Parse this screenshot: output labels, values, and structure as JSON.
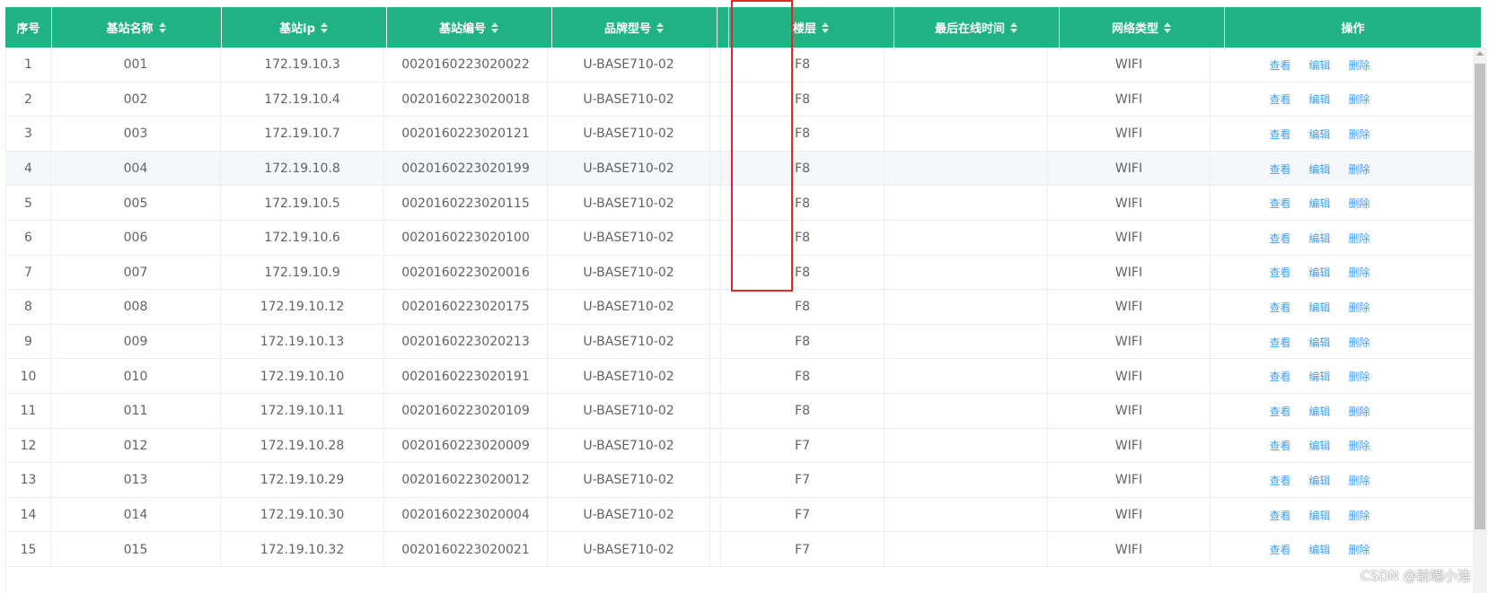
{
  "table": {
    "headers": [
      {
        "label": "序号",
        "sortable": false
      },
      {
        "label": "基站名称",
        "sortable": true
      },
      {
        "label": "基站ip",
        "sortable": true
      },
      {
        "label": "基站编号",
        "sortable": true
      },
      {
        "label": "品牌型号",
        "sortable": true
      },
      {
        "label": "",
        "sortable": false
      },
      {
        "label": "楼层",
        "sortable": true
      },
      {
        "label": "最后在线时间",
        "sortable": true
      },
      {
        "label": "网络类型",
        "sortable": true
      },
      {
        "label": "操作",
        "sortable": false
      }
    ],
    "actions": [
      "查看",
      "编辑",
      "删除"
    ],
    "highlight_row_index": 3,
    "rows": [
      {
        "idx": "1",
        "name": "001",
        "ip": "172.19.10.3",
        "code": "0020160223020022",
        "model": "U-BASE710-02",
        "blank": "",
        "floor": "F8",
        "last_online": "",
        "net": "WIFI"
      },
      {
        "idx": "2",
        "name": "002",
        "ip": "172.19.10.4",
        "code": "0020160223020018",
        "model": "U-BASE710-02",
        "blank": "",
        "floor": "F8",
        "last_online": "",
        "net": "WIFI"
      },
      {
        "idx": "3",
        "name": "003",
        "ip": "172.19.10.7",
        "code": "0020160223020121",
        "model": "U-BASE710-02",
        "blank": "",
        "floor": "F8",
        "last_online": "",
        "net": "WIFI"
      },
      {
        "idx": "4",
        "name": "004",
        "ip": "172.19.10.8",
        "code": "0020160223020199",
        "model": "U-BASE710-02",
        "blank": "",
        "floor": "F8",
        "last_online": "",
        "net": "WIFI"
      },
      {
        "idx": "5",
        "name": "005",
        "ip": "172.19.10.5",
        "code": "0020160223020115",
        "model": "U-BASE710-02",
        "blank": "",
        "floor": "F8",
        "last_online": "",
        "net": "WIFI"
      },
      {
        "idx": "6",
        "name": "006",
        "ip": "172.19.10.6",
        "code": "0020160223020100",
        "model": "U-BASE710-02",
        "blank": "",
        "floor": "F8",
        "last_online": "",
        "net": "WIFI"
      },
      {
        "idx": "7",
        "name": "007",
        "ip": "172.19.10.9",
        "code": "0020160223020016",
        "model": "U-BASE710-02",
        "blank": "",
        "floor": "F8",
        "last_online": "",
        "net": "WIFI"
      },
      {
        "idx": "8",
        "name": "008",
        "ip": "172.19.10.12",
        "code": "0020160223020175",
        "model": "U-BASE710-02",
        "blank": "",
        "floor": "F8",
        "last_online": "",
        "net": "WIFI"
      },
      {
        "idx": "9",
        "name": "009",
        "ip": "172.19.10.13",
        "code": "0020160223020213",
        "model": "U-BASE710-02",
        "blank": "",
        "floor": "F8",
        "last_online": "",
        "net": "WIFI"
      },
      {
        "idx": "10",
        "name": "010",
        "ip": "172.19.10.10",
        "code": "0020160223020191",
        "model": "U-BASE710-02",
        "blank": "",
        "floor": "F8",
        "last_online": "",
        "net": "WIFI"
      },
      {
        "idx": "11",
        "name": "011",
        "ip": "172.19.10.11",
        "code": "0020160223020109",
        "model": "U-BASE710-02",
        "blank": "",
        "floor": "F8",
        "last_online": "",
        "net": "WIFI"
      },
      {
        "idx": "12",
        "name": "012",
        "ip": "172.19.10.28",
        "code": "0020160223020009",
        "model": "U-BASE710-02",
        "blank": "",
        "floor": "F7",
        "last_online": "",
        "net": "WIFI"
      },
      {
        "idx": "13",
        "name": "013",
        "ip": "172.19.10.29",
        "code": "0020160223020012",
        "model": "U-BASE710-02",
        "blank": "",
        "floor": "F7",
        "last_online": "",
        "net": "WIFI"
      },
      {
        "idx": "14",
        "name": "014",
        "ip": "172.19.10.30",
        "code": "0020160223020004",
        "model": "U-BASE710-02",
        "blank": "",
        "floor": "F7",
        "last_online": "",
        "net": "WIFI"
      },
      {
        "idx": "15",
        "name": "015",
        "ip": "172.19.10.32",
        "code": "0020160223020021",
        "model": "U-BASE710-02",
        "blank": "",
        "floor": "F7",
        "last_online": "",
        "net": "WIFI"
      }
    ]
  },
  "watermark": "CSDN @前端小浩",
  "colors": {
    "header_bg": "#21b283",
    "link": "#409eff",
    "annotation": "#e0282a"
  }
}
